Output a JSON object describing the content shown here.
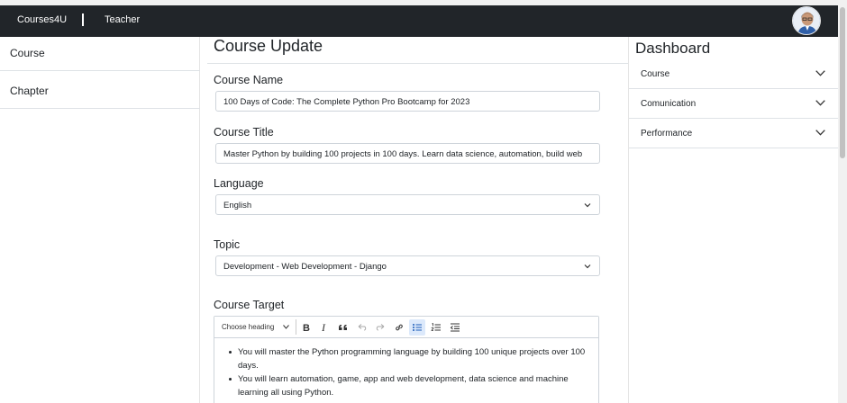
{
  "navbar": {
    "brand": "Courses4U",
    "separator": "|",
    "role": "Teacher",
    "avatar_icon": "user-avatar-icon"
  },
  "left_sidebar": {
    "items": [
      {
        "label": "Course"
      },
      {
        "label": "Chapter"
      }
    ]
  },
  "main": {
    "title": "Course Update",
    "course_name": {
      "label": "Course Name",
      "value": "100 Days of Code: The Complete Python Pro Bootcamp for 2023"
    },
    "course_title": {
      "label": "Course Title",
      "value": "Master Python by building 100 projects in 100 days. Learn data science, automation, build web"
    },
    "language": {
      "label": "Language",
      "selected": "English"
    },
    "topic": {
      "label": "Topic",
      "selected": "Development - Web Development - Django"
    },
    "course_target": {
      "label": "Course Target",
      "heading_select": "Choose heading",
      "toolbar_icons": [
        "bold-icon",
        "italic-icon",
        "blockquote-icon",
        "undo-icon",
        "redo-icon",
        "link-icon",
        "bulleted-list-icon",
        "numbered-list-icon",
        "outdent-icon"
      ],
      "bullets": [
        "You will master the Python programming language by building 100 unique projects over 100 days.",
        "You will learn automation, game, app and web development, data science and machine learning all using Python."
      ]
    }
  },
  "right_sidebar": {
    "title": "Dashboard",
    "accordion": [
      {
        "label": "Course"
      },
      {
        "label": "Comunication"
      },
      {
        "label": "Performance"
      }
    ]
  },
  "colors": {
    "navbar_bg": "#212529",
    "active_tool_bg": "#dce9fb"
  }
}
